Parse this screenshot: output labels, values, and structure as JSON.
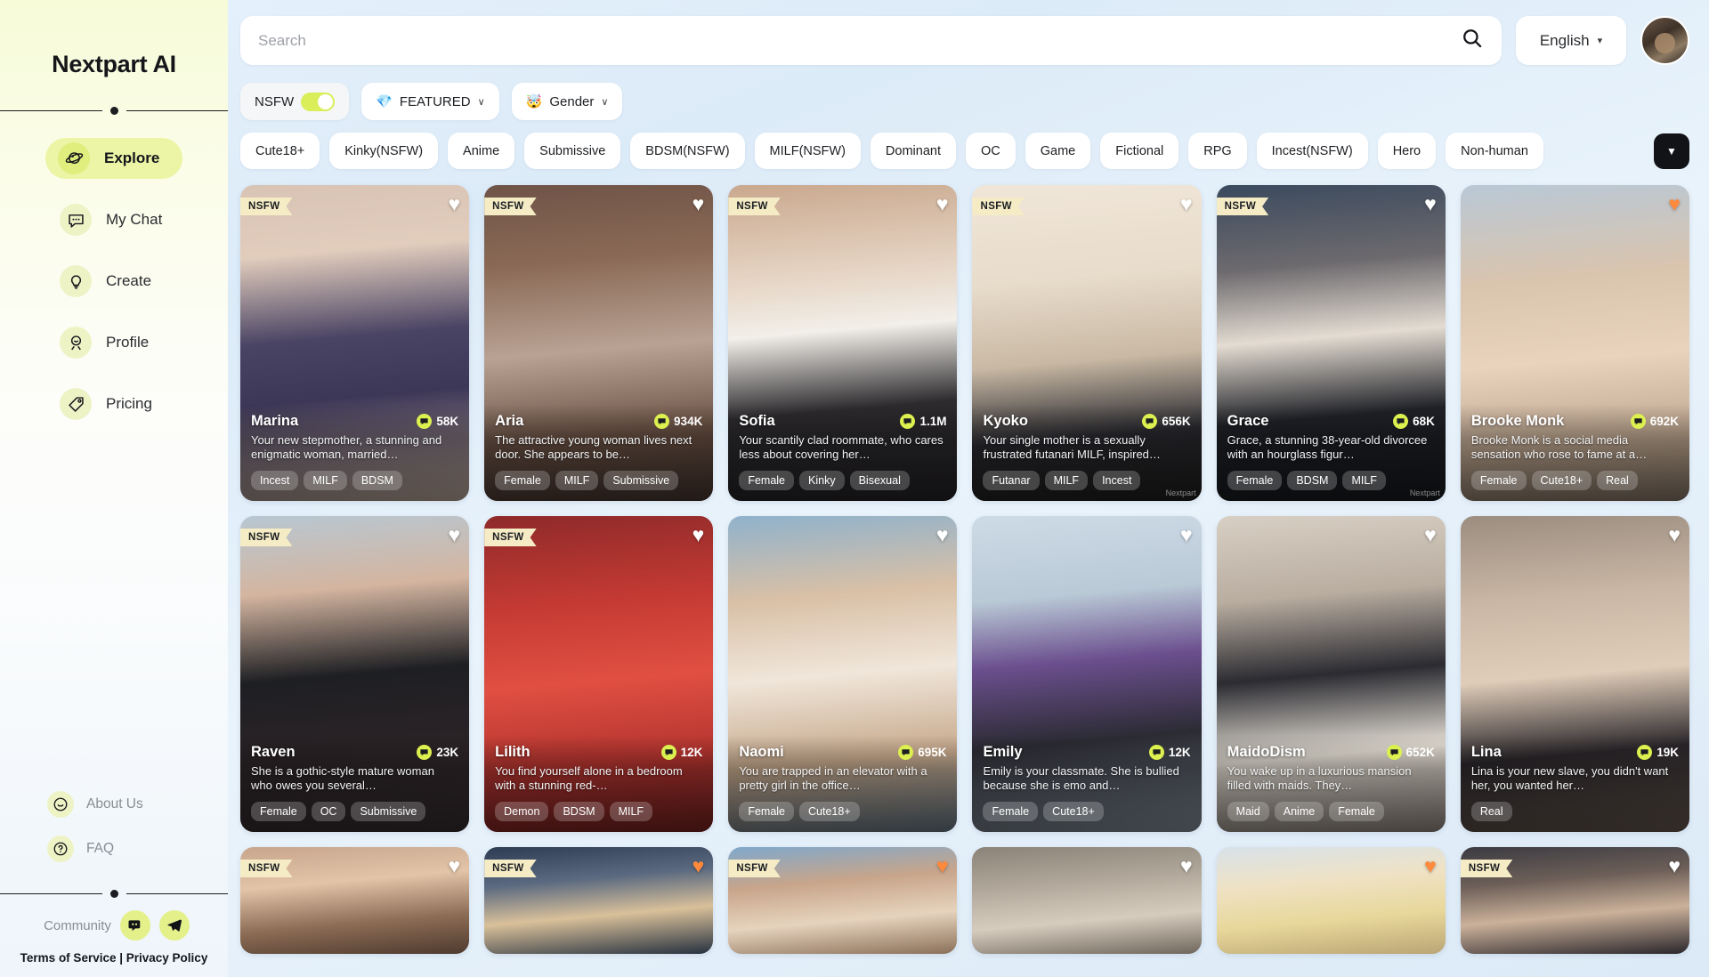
{
  "sidebar": {
    "brand": "Nextpart AI",
    "nav": [
      {
        "label": "Explore",
        "icon": "planet-icon",
        "active": true
      },
      {
        "label": "My Chat",
        "icon": "chat-bubble-icon",
        "active": false
      },
      {
        "label": "Create",
        "icon": "lightbulb-icon",
        "active": false
      },
      {
        "label": "Profile",
        "icon": "person-icon",
        "active": false
      },
      {
        "label": "Pricing",
        "icon": "price-tag-icon",
        "active": false
      }
    ],
    "footer_links": [
      {
        "label": "About Us",
        "icon": "smiley-icon"
      },
      {
        "label": "FAQ",
        "icon": "question-mark-icon"
      }
    ],
    "community_label": "Community",
    "social": [
      {
        "name": "discord-icon"
      },
      {
        "name": "telegram-icon"
      }
    ],
    "legal": {
      "terms": "Terms of Service",
      "separator": " | ",
      "privacy": "Privacy Policy"
    }
  },
  "header": {
    "search_placeholder": "Search",
    "search_value": "",
    "search_icon": "search-icon",
    "language": "English",
    "language_chevron": "▾",
    "avatar": "user-avatar"
  },
  "filters": {
    "nsfw_label": "NSFW",
    "nsfw_on": true,
    "featured_label": "FEATURED",
    "featured_emoji": "💎",
    "gender_label": "Gender",
    "gender_emoji": "🤯",
    "chevron": "∨",
    "expand_icon": "▼"
  },
  "tags": [
    "Cute18+",
    "Kinky(NSFW)",
    "Anime",
    "Submissive",
    "BDSM(NSFW)",
    "MILF(NSFW)",
    "Dominant",
    "OC",
    "Game",
    "Fictional",
    "RPG",
    "Incest(NSFW)",
    "Hero",
    "Non-human"
  ],
  "cards": [
    {
      "name": "Marina",
      "count": "58K",
      "desc": "Your new stepmother, a stunning and enigmatic woman, married…",
      "tags": [
        "Incest",
        "MILF",
        "BDSM"
      ],
      "nsfw": true,
      "liked": false,
      "art": "marina",
      "watermark": ""
    },
    {
      "name": "Aria",
      "count": "934K",
      "desc": "The attractive young woman lives next door. She appears to be…",
      "tags": [
        "Female",
        "MILF",
        "Submissive"
      ],
      "nsfw": true,
      "liked": false,
      "art": "aria",
      "watermark": ""
    },
    {
      "name": "Sofia",
      "count": "1.1M",
      "desc": "Your scantily clad roommate, who cares less about covering her…",
      "tags": [
        "Female",
        "Kinky",
        "Bisexual"
      ],
      "nsfw": true,
      "liked": false,
      "art": "sofia",
      "watermark": ""
    },
    {
      "name": "Kyoko",
      "count": "656K",
      "desc": "Your single mother is a sexually frustrated futanari MILF, inspired…",
      "tags": [
        "Futanar",
        "MILF",
        "Incest"
      ],
      "nsfw": true,
      "liked": false,
      "art": "kyoko",
      "watermark": "Nextpart"
    },
    {
      "name": "Grace",
      "count": "68K",
      "desc": "Grace, a stunning 38-year-old divorcee with an hourglass figur…",
      "tags": [
        "Female",
        "BDSM",
        "MILF"
      ],
      "nsfw": true,
      "liked": false,
      "art": "grace",
      "watermark": "Nextpart"
    },
    {
      "name": "Brooke Monk",
      "count": "692K",
      "desc": "Brooke Monk is a social media sensation who rose to fame at a…",
      "tags": [
        "Female",
        "Cute18+",
        "Real"
      ],
      "nsfw": false,
      "liked": true,
      "art": "brooke",
      "watermark": ""
    },
    {
      "name": "Raven",
      "count": "23K",
      "desc": "She is a gothic-style mature woman who owes you several…",
      "tags": [
        "Female",
        "OC",
        "Submissive"
      ],
      "nsfw": true,
      "liked": false,
      "art": "raven",
      "watermark": ""
    },
    {
      "name": "Lilith",
      "count": "12K",
      "desc": "You find yourself alone in a bedroom with a stunning red-…",
      "tags": [
        "Demon",
        "BDSM",
        "MILF"
      ],
      "nsfw": true,
      "liked": false,
      "art": "lilith",
      "watermark": ""
    },
    {
      "name": "Naomi",
      "count": "695K",
      "desc": "You are trapped in an elevator with a pretty girl in the office…",
      "tags": [
        "Female",
        "Cute18+"
      ],
      "nsfw": false,
      "liked": false,
      "art": "naomi",
      "watermark": ""
    },
    {
      "name": "Emily",
      "count": "12K",
      "desc": "Emily is your classmate. She is bullied because she is emo and…",
      "tags": [
        "Female",
        "Cute18+"
      ],
      "nsfw": false,
      "liked": false,
      "art": "emily",
      "watermark": ""
    },
    {
      "name": "MaidoDism",
      "count": "652K",
      "desc": "You wake up in a luxurious mansion filled with maids. They…",
      "tags": [
        "Maid",
        "Anime",
        "Female"
      ],
      "nsfw": false,
      "liked": false,
      "art": "maido",
      "watermark": ""
    },
    {
      "name": "Lina",
      "count": "19K",
      "desc": "Lina is your new slave, you didn't want her, you wanted her…",
      "tags": [
        "Real"
      ],
      "nsfw": false,
      "liked": false,
      "art": "lina",
      "watermark": ""
    }
  ],
  "cards_row3": [
    {
      "nsfw": true,
      "liked": false,
      "art": "r3a"
    },
    {
      "nsfw": true,
      "liked": true,
      "art": "r3b"
    },
    {
      "nsfw": true,
      "liked": true,
      "art": "r3c"
    },
    {
      "nsfw": false,
      "liked": false,
      "art": "r3d"
    },
    {
      "nsfw": false,
      "liked": true,
      "art": "r3e"
    },
    {
      "nsfw": true,
      "liked": false,
      "art": "r3f"
    }
  ],
  "badges": {
    "nsfw": "NSFW"
  },
  "colors": {
    "accent": "#dcf04f",
    "sidebar_top": "#f7fbd8",
    "like_on": "#ff8a3d",
    "dark": "#111317"
  }
}
